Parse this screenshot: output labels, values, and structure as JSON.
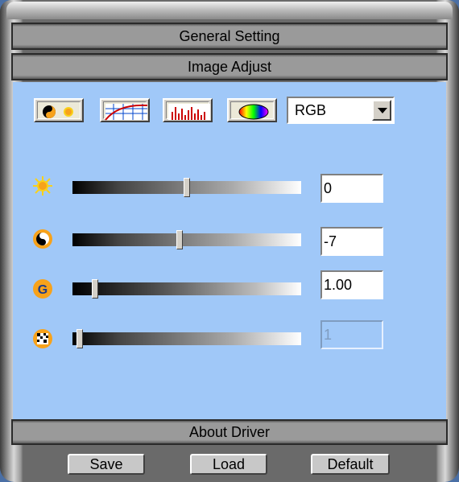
{
  "tabs": {
    "general": "General Setting",
    "image": "Image Adjust",
    "about": "About Driver"
  },
  "toolbar": {
    "color_mode": "RGB"
  },
  "sliders": [
    {
      "name": "brightness",
      "value": "0",
      "position_fraction": 0.5,
      "enabled": true
    },
    {
      "name": "contrast",
      "value": "-7",
      "position_fraction": 0.47,
      "enabled": true
    },
    {
      "name": "gamma",
      "value": "1.00",
      "position_fraction": 0.1,
      "enabled": true
    },
    {
      "name": "sharpness",
      "value": "1",
      "position_fraction": 0.03,
      "enabled": false
    }
  ],
  "footer": {
    "save": "Save",
    "load": "Load",
    "default": "Default"
  },
  "colors": {
    "panel": "#a0c8f8",
    "bar": "#9a9a9a"
  }
}
